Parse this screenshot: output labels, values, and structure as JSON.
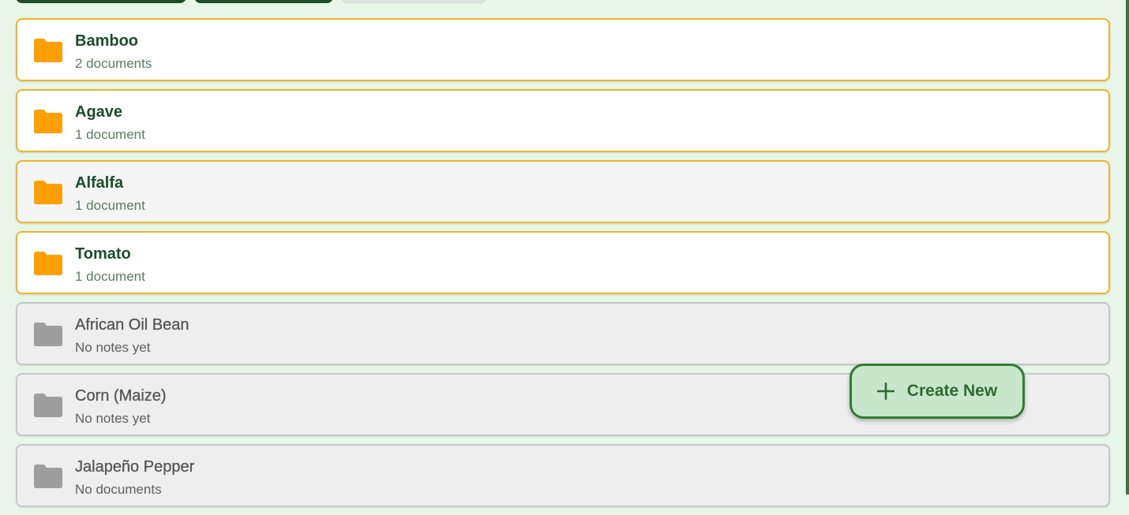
{
  "colors": {
    "page_bg": "#e8f5e9",
    "accent_green": "#2e7d32",
    "folder_orange": "#ffa000",
    "folder_grey": "#9e9e9e",
    "active_border": "#f0b429"
  },
  "folders": [
    {
      "name": "Bamboo",
      "count": "2 documents",
      "state": "active",
      "icon": "folder-icon"
    },
    {
      "name": "Agave",
      "count": "1 document",
      "state": "active",
      "icon": "folder-icon"
    },
    {
      "name": "Alfalfa",
      "count": "1 document",
      "state": "active-hover",
      "icon": "folder-icon"
    },
    {
      "name": "Tomato",
      "count": "1 document",
      "state": "active",
      "icon": "folder-icon"
    },
    {
      "name": "African Oil Bean",
      "count": "No notes yet",
      "state": "empty",
      "icon": "folder-icon"
    },
    {
      "name": "Corn (Maize)",
      "count": "No notes yet",
      "state": "empty",
      "icon": "folder-icon"
    },
    {
      "name": "Jalapeño Pepper",
      "count": "No documents",
      "state": "empty",
      "icon": "folder-icon"
    }
  ],
  "create_button": {
    "label": "Create New",
    "icon": "plus-icon"
  }
}
